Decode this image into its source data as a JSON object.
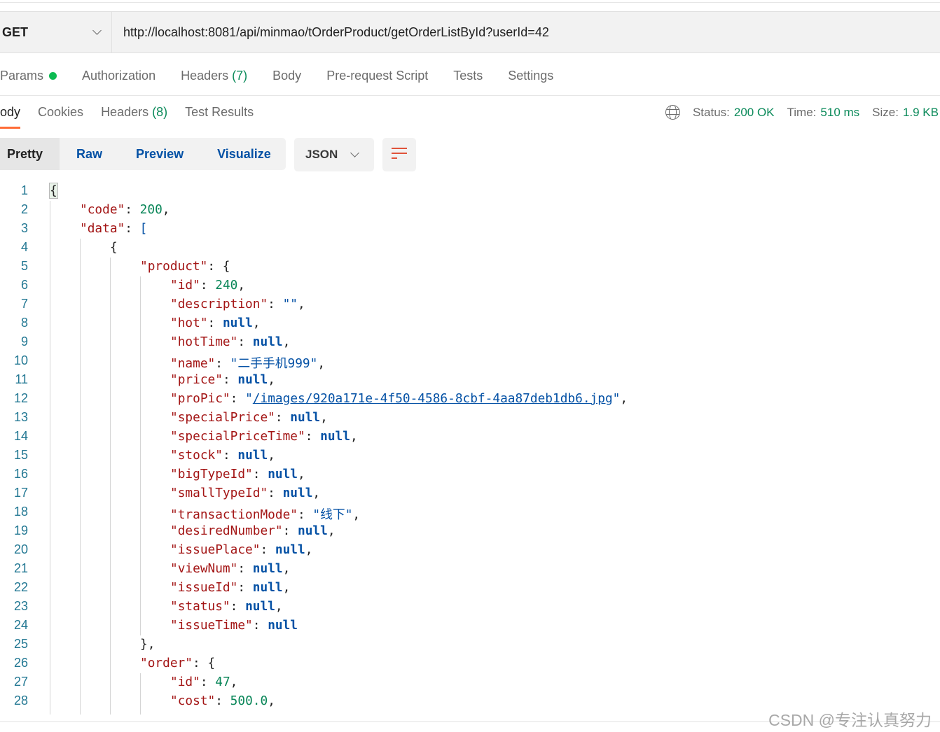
{
  "request": {
    "method": "GET",
    "url": "http://localhost:8081/api/minmao/tOrderProduct/getOrderListById?userId=42"
  },
  "request_tabs": [
    {
      "label": "Params",
      "has_dot": true
    },
    {
      "label": "Authorization"
    },
    {
      "label": "Headers",
      "count": "(7)"
    },
    {
      "label": "Body"
    },
    {
      "label": "Pre-request Script"
    },
    {
      "label": "Tests"
    },
    {
      "label": "Settings"
    }
  ],
  "response_tabs": [
    {
      "label": "ody",
      "active": true
    },
    {
      "label": "Cookies"
    },
    {
      "label": "Headers",
      "count": "(8)"
    },
    {
      "label": "Test Results"
    }
  ],
  "status": {
    "status_label": "Status:",
    "status_value": "200 OK",
    "time_label": "Time:",
    "time_value": "510 ms",
    "size_label": "Size:",
    "size_value": "1.9 KB",
    "icon": "globe-icon"
  },
  "view_modes": [
    "Pretty",
    "Raw",
    "Preview",
    "Visualize"
  ],
  "selected_view": "Pretty",
  "format": "JSON",
  "colors": {
    "accent": "#ff6c37",
    "success": "#0b8a5a",
    "key": "#a31515",
    "number": "#098658",
    "string": "#0451a5"
  },
  "code_lines": [
    {
      "d": 0,
      "t": [
        [
          "p",
          "{"
        ]
      ]
    },
    {
      "d": 1,
      "t": [
        [
          "k",
          "\"code\""
        ],
        [
          "p",
          ": "
        ],
        [
          "n",
          "200"
        ],
        [
          "p",
          ","
        ]
      ]
    },
    {
      "d": 1,
      "t": [
        [
          "k",
          "\"data\""
        ],
        [
          "p",
          ": "
        ],
        [
          "s",
          "["
        ]
      ]
    },
    {
      "d": 2,
      "t": [
        [
          "p",
          "{"
        ]
      ]
    },
    {
      "d": 3,
      "t": [
        [
          "k",
          "\"product\""
        ],
        [
          "p",
          ": {"
        ]
      ]
    },
    {
      "d": 4,
      "t": [
        [
          "k",
          "\"id\""
        ],
        [
          "p",
          ": "
        ],
        [
          "n",
          "240"
        ],
        [
          "p",
          ","
        ]
      ]
    },
    {
      "d": 4,
      "t": [
        [
          "k",
          "\"description\""
        ],
        [
          "p",
          ": "
        ],
        [
          "s",
          "\"\""
        ],
        [
          "p",
          ","
        ]
      ]
    },
    {
      "d": 4,
      "t": [
        [
          "k",
          "\"hot\""
        ],
        [
          "p",
          ": "
        ],
        [
          "b",
          "null"
        ],
        [
          "p",
          ","
        ]
      ]
    },
    {
      "d": 4,
      "t": [
        [
          "k",
          "\"hotTime\""
        ],
        [
          "p",
          ": "
        ],
        [
          "b",
          "null"
        ],
        [
          "p",
          ","
        ]
      ]
    },
    {
      "d": 4,
      "t": [
        [
          "k",
          "\"name\""
        ],
        [
          "p",
          ": "
        ],
        [
          "s",
          "\"二手手机999\""
        ],
        [
          "p",
          ","
        ]
      ]
    },
    {
      "d": 4,
      "t": [
        [
          "k",
          "\"price\""
        ],
        [
          "p",
          ": "
        ],
        [
          "b",
          "null"
        ],
        [
          "p",
          ","
        ]
      ]
    },
    {
      "d": 4,
      "t": [
        [
          "k",
          "\"proPic\""
        ],
        [
          "p",
          ": "
        ],
        [
          "s",
          "\""
        ],
        [
          "l",
          "/images/920a171e-4f50-4586-8cbf-4aa87deb1db6.jpg"
        ],
        [
          "s",
          "\""
        ],
        [
          "p",
          ","
        ]
      ]
    },
    {
      "d": 4,
      "t": [
        [
          "k",
          "\"specialPrice\""
        ],
        [
          "p",
          ": "
        ],
        [
          "b",
          "null"
        ],
        [
          "p",
          ","
        ]
      ]
    },
    {
      "d": 4,
      "t": [
        [
          "k",
          "\"specialPriceTime\""
        ],
        [
          "p",
          ": "
        ],
        [
          "b",
          "null"
        ],
        [
          "p",
          ","
        ]
      ]
    },
    {
      "d": 4,
      "t": [
        [
          "k",
          "\"stock\""
        ],
        [
          "p",
          ": "
        ],
        [
          "b",
          "null"
        ],
        [
          "p",
          ","
        ]
      ]
    },
    {
      "d": 4,
      "t": [
        [
          "k",
          "\"bigTypeId\""
        ],
        [
          "p",
          ": "
        ],
        [
          "b",
          "null"
        ],
        [
          "p",
          ","
        ]
      ]
    },
    {
      "d": 4,
      "t": [
        [
          "k",
          "\"smallTypeId\""
        ],
        [
          "p",
          ": "
        ],
        [
          "b",
          "null"
        ],
        [
          "p",
          ","
        ]
      ]
    },
    {
      "d": 4,
      "t": [
        [
          "k",
          "\"transactionMode\""
        ],
        [
          "p",
          ": "
        ],
        [
          "s",
          "\"线下\""
        ],
        [
          "p",
          ","
        ]
      ]
    },
    {
      "d": 4,
      "t": [
        [
          "k",
          "\"desiredNumber\""
        ],
        [
          "p",
          ": "
        ],
        [
          "b",
          "null"
        ],
        [
          "p",
          ","
        ]
      ]
    },
    {
      "d": 4,
      "t": [
        [
          "k",
          "\"issuePlace\""
        ],
        [
          "p",
          ": "
        ],
        [
          "b",
          "null"
        ],
        [
          "p",
          ","
        ]
      ]
    },
    {
      "d": 4,
      "t": [
        [
          "k",
          "\"viewNum\""
        ],
        [
          "p",
          ": "
        ],
        [
          "b",
          "null"
        ],
        [
          "p",
          ","
        ]
      ]
    },
    {
      "d": 4,
      "t": [
        [
          "k",
          "\"issueId\""
        ],
        [
          "p",
          ": "
        ],
        [
          "b",
          "null"
        ],
        [
          "p",
          ","
        ]
      ]
    },
    {
      "d": 4,
      "t": [
        [
          "k",
          "\"status\""
        ],
        [
          "p",
          ": "
        ],
        [
          "b",
          "null"
        ],
        [
          "p",
          ","
        ]
      ]
    },
    {
      "d": 4,
      "t": [
        [
          "k",
          "\"issueTime\""
        ],
        [
          "p",
          ": "
        ],
        [
          "b",
          "null"
        ]
      ]
    },
    {
      "d": 3,
      "t": [
        [
          "p",
          "},"
        ]
      ]
    },
    {
      "d": 3,
      "t": [
        [
          "k",
          "\"order\""
        ],
        [
          "p",
          ": {"
        ]
      ]
    },
    {
      "d": 4,
      "t": [
        [
          "k",
          "\"id\""
        ],
        [
          "p",
          ": "
        ],
        [
          "n",
          "47"
        ],
        [
          "p",
          ","
        ]
      ]
    },
    {
      "d": 4,
      "t": [
        [
          "k",
          "\"cost\""
        ],
        [
          "p",
          ": "
        ],
        [
          "n",
          "500.0"
        ],
        [
          "p",
          ","
        ]
      ]
    }
  ],
  "watermark": "CSDN @专注认真努力"
}
